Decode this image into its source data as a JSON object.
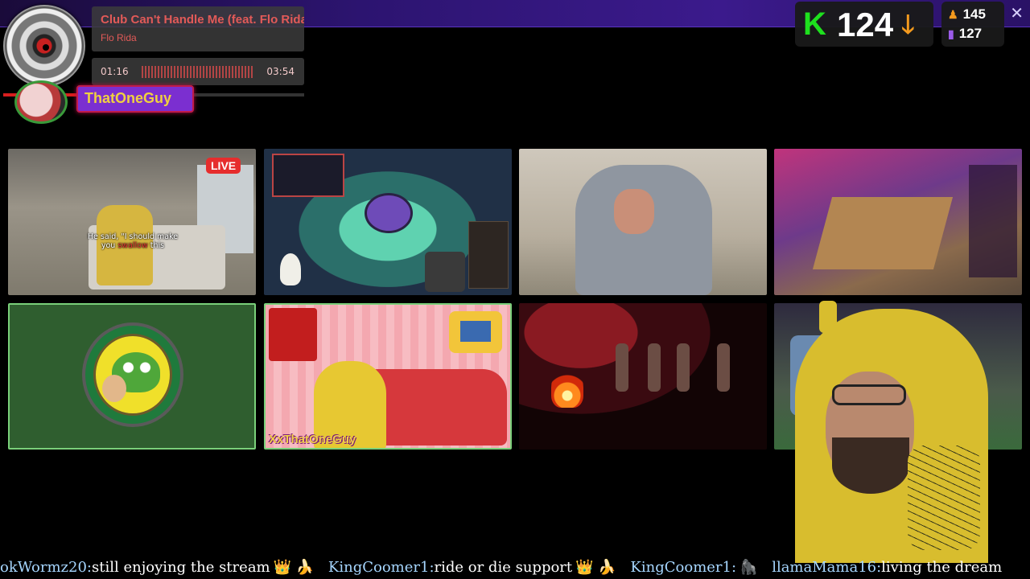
{
  "window": {
    "close_label": "✕"
  },
  "now_playing": {
    "title": "Club Can't Handle Me (feat. Flo Rida)",
    "artist": "Flo Rida",
    "elapsed": "01:16",
    "total": "03:54",
    "progress": 0.32
  },
  "streamer": {
    "name": "ThatOneGuy"
  },
  "kick_counter": {
    "logo": "K",
    "count": "124",
    "trend_icon": "arrow-down-icon",
    "trend_glyph": "🡓"
  },
  "stats": {
    "followers": "145",
    "viewers": "127",
    "followers_icon": "person-icon",
    "viewers_icon": "bar-chart-icon"
  },
  "tiles": {
    "live_badge": "LIVE",
    "caption_pre": "He said, \"I should make you ",
    "caption_hl": "swallow",
    "caption_post": " this",
    "banner": "XxThatOneGuy"
  },
  "ticker": [
    {
      "user": "okWormz20:",
      "message": "still enjoying the stream",
      "emote": "👑 🍌"
    },
    {
      "user": "KingCoomer1:",
      "message": "ride or die support",
      "emote": "👑 🍌"
    },
    {
      "user": "KingCoomer1:",
      "message": "",
      "emote": "🦍"
    },
    {
      "user": "llamaMama16:",
      "message": "living the dream",
      "emote": ""
    }
  ]
}
